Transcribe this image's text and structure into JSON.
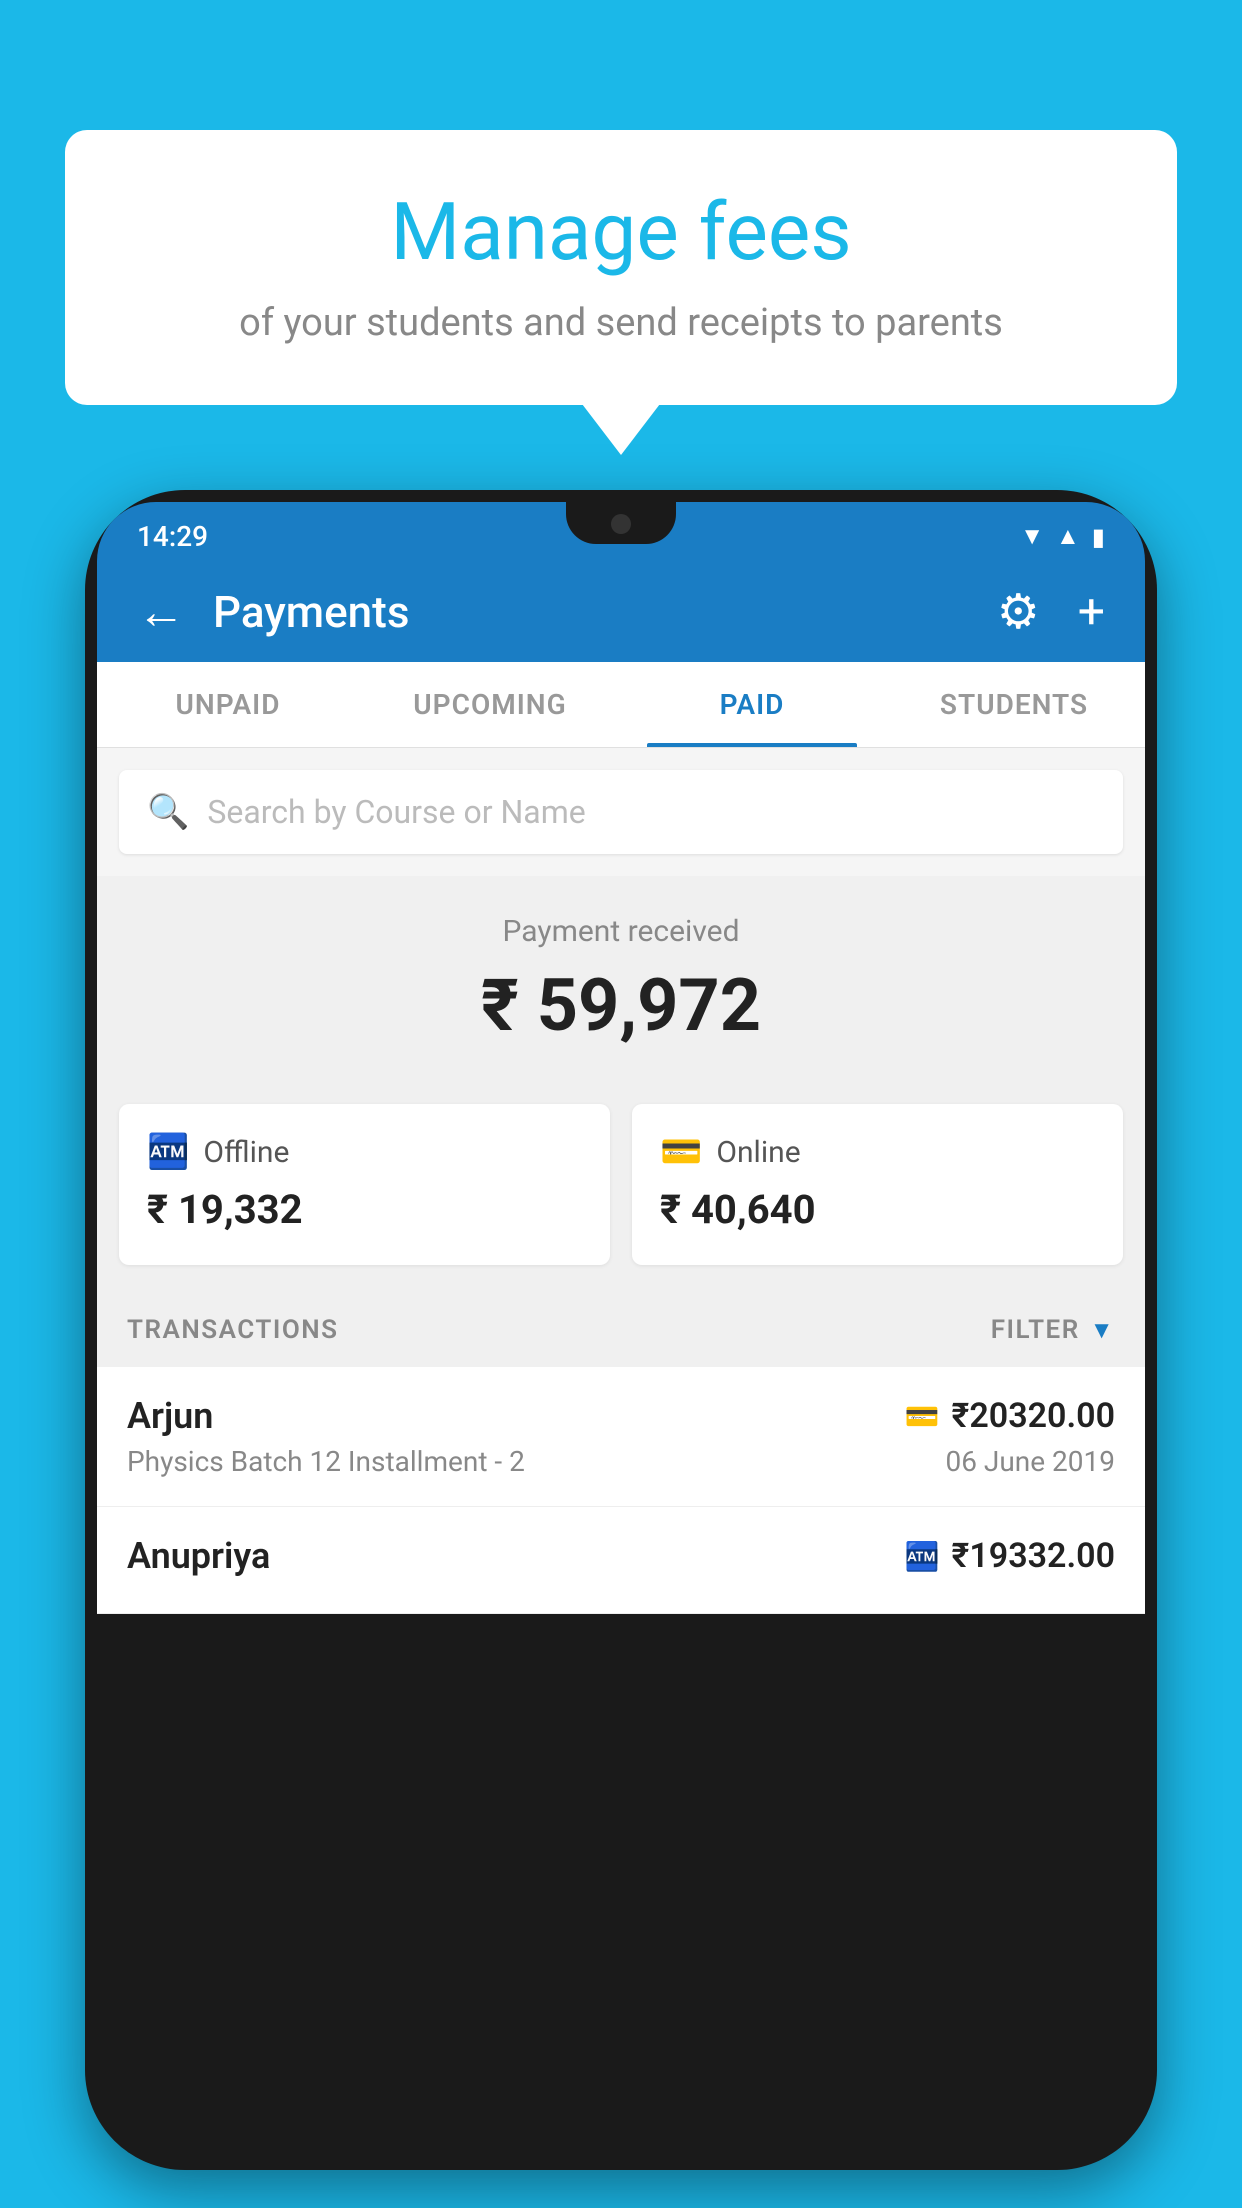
{
  "background_color": "#1bb8e8",
  "bubble": {
    "title": "Manage fees",
    "subtitle": "of your students and send receipts to parents"
  },
  "phone": {
    "status_bar": {
      "time": "14:29"
    },
    "app_bar": {
      "title": "Payments",
      "back_label": "←"
    },
    "tabs": [
      {
        "label": "UNPAID",
        "active": false
      },
      {
        "label": "UPCOMING",
        "active": false
      },
      {
        "label": "PAID",
        "active": true
      },
      {
        "label": "STUDENTS",
        "active": false
      }
    ],
    "search": {
      "placeholder": "Search by Course or Name"
    },
    "payment_summary": {
      "label": "Payment received",
      "amount": "₹ 59,972"
    },
    "payment_cards": [
      {
        "label": "Offline",
        "amount": "₹ 19,332",
        "icon": "offline"
      },
      {
        "label": "Online",
        "amount": "₹ 40,640",
        "icon": "online"
      }
    ],
    "transactions_header": {
      "label": "TRANSACTIONS",
      "filter_label": "FILTER"
    },
    "transactions": [
      {
        "name": "Arjun",
        "course": "Physics Batch 12 Installment - 2",
        "amount": "₹20320.00",
        "date": "06 June 2019",
        "icon": "card"
      },
      {
        "name": "Anupriya",
        "course": "",
        "amount": "₹19332.00",
        "date": "",
        "icon": "cash"
      }
    ]
  }
}
